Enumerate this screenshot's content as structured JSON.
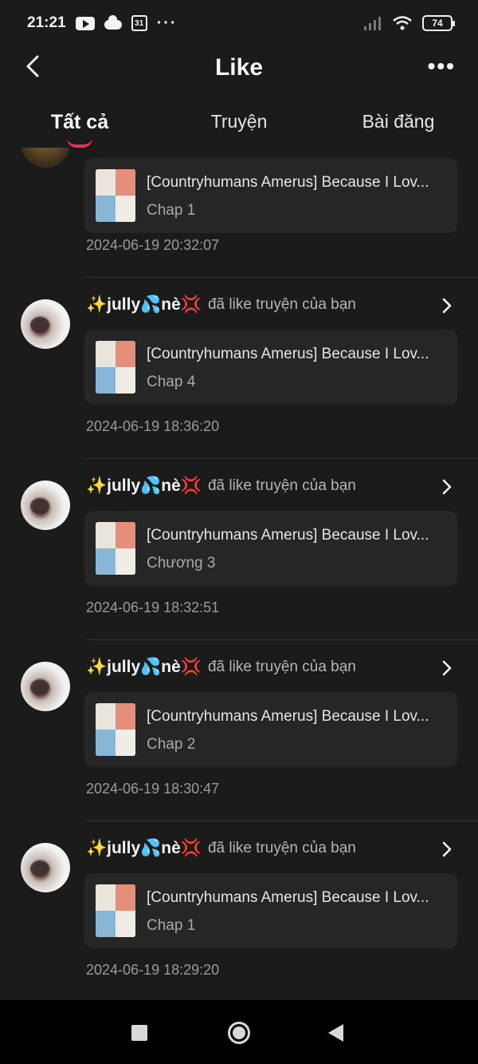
{
  "status_bar": {
    "time": "21:21",
    "calendar_day": "31",
    "more": "···",
    "battery": "74"
  },
  "header": {
    "title": "Like",
    "more": "•••"
  },
  "tabs": [
    {
      "label": "Tất cả",
      "active": true
    },
    {
      "label": "Truyện",
      "active": false
    },
    {
      "label": "Bài đăng",
      "active": false
    }
  ],
  "items": [
    {
      "card_title": "[Countryhumans Amerus] Because I Lov...",
      "card_sub": "Chap 1",
      "time": "2024-06-19 20:32:07"
    },
    {
      "user_name": "✨jully💦nè💢",
      "action": "đã like truyện của bạn",
      "card_title": "[Countryhumans Amerus] Because I Lov...",
      "card_sub": "Chap 4",
      "time": "2024-06-19 18:36:20"
    },
    {
      "user_name": "✨jully💦nè💢",
      "action": "đã like truyện của bạn",
      "card_title": "[Countryhumans Amerus] Because I Lov...",
      "card_sub": "Chương 3",
      "time": "2024-06-19 18:32:51"
    },
    {
      "user_name": "✨jully💦nè💢",
      "action": "đã like truyện của bạn",
      "card_title": "[Countryhumans Amerus] Because I Lov...",
      "card_sub": "Chap 2",
      "time": "2024-06-19 18:30:47"
    },
    {
      "user_name": "✨jully💦nè💢",
      "action": "đã like truyện của bạn",
      "card_title": "[Countryhumans Amerus] Because I Lov...",
      "card_sub": "Chap 1",
      "time": "2024-06-19 18:29:20"
    }
  ],
  "icons": {
    "back": "chevron-left-icon",
    "row_chevron": "chevron-right-icon",
    "nav_recents": "square-icon",
    "nav_home": "circle-icon",
    "nav_back": "triangle-back-icon"
  },
  "colors": {
    "accent": "#e8305e",
    "background": "#1b1b1b",
    "card": "#262626"
  }
}
